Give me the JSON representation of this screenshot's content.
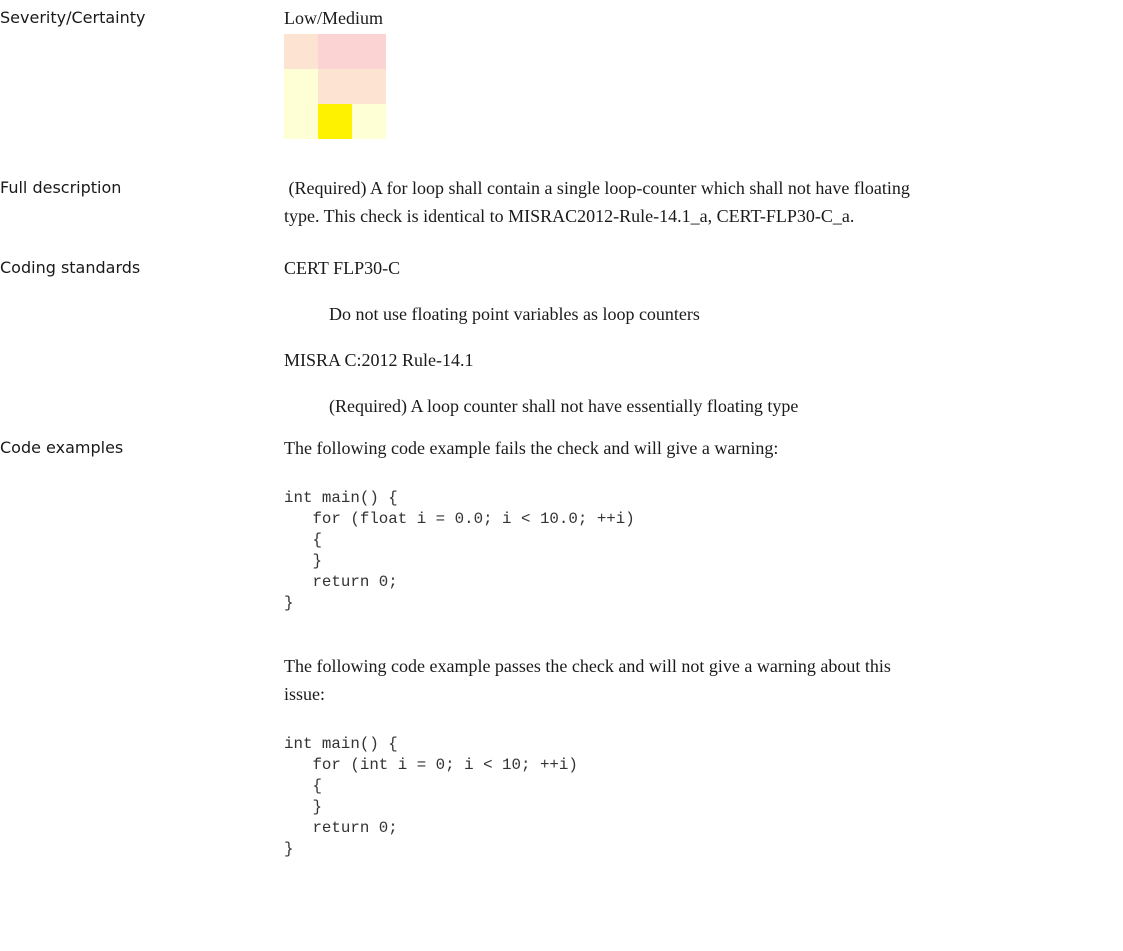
{
  "rows": {
    "severity": {
      "label": "Severity/Certainty",
      "value": "Low/Medium",
      "matrix": {
        "cells": [
          [
            "#fde3d2",
            "#fcd3d3",
            "#fcd3d3"
          ],
          [
            "#ffffd6",
            "#fde3d2",
            "#fde3d2"
          ],
          [
            "#ffffd6",
            "#fff200",
            "#ffffd6"
          ]
        ]
      }
    },
    "full_description": {
      "label": "Full description",
      "line1": " (Required) A for loop shall contain a single loop-counter which shall not have floating",
      "line2": "type. This check is identical to MISRAC2012-Rule-14.1_a, CERT-FLP30-C_a."
    },
    "coding_standards": {
      "label": "Coding standards",
      "standard1_name": "CERT FLP30-C",
      "standard1_desc": "Do not use floating point variables as loop counters",
      "standard2_name": "MISRA C:2012 Rule-14.1",
      "standard2_desc": "(Required) A loop counter shall not have essentially floating type"
    },
    "code_examples": {
      "label": "Code examples",
      "fail_intro": "The following code example fails the check and will give a warning:",
      "fail_code": "int main() {\n   for (float i = 0.0; i < 10.0; ++i)\n   {\n   }\n   return 0;\n}",
      "pass_intro_line1": "The following code example passes the check and will not give a warning about this",
      "pass_intro_line2": "issue:",
      "pass_code": "int main() {\n   for (int i = 0; i < 10; ++i)\n   {\n   }\n   return 0;\n}"
    }
  }
}
